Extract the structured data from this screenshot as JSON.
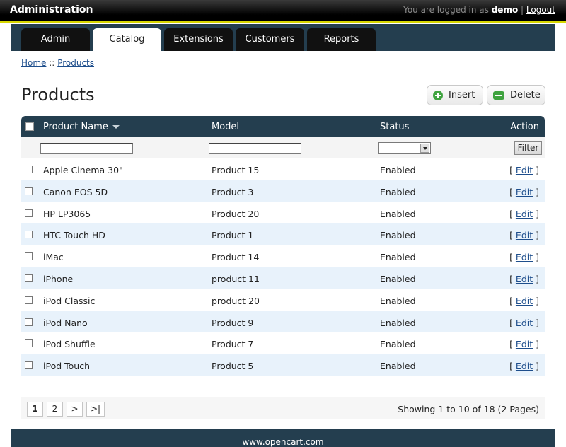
{
  "header": {
    "title": "Administration",
    "logged_in_text": "You are logged in as",
    "username": "demo",
    "separator": "|",
    "logout_label": "Logout"
  },
  "tabs": [
    {
      "label": "Admin",
      "active": false
    },
    {
      "label": "Catalog",
      "active": true
    },
    {
      "label": "Extensions",
      "active": false
    },
    {
      "label": "Customers",
      "active": false
    },
    {
      "label": "Reports",
      "active": false
    }
  ],
  "breadcrumb": {
    "home": "Home",
    "separator": "::",
    "current": "Products"
  },
  "page": {
    "title": "Products",
    "insert_label": "Insert",
    "delete_label": "Delete"
  },
  "table": {
    "columns": {
      "name": "Product Name",
      "model": "Model",
      "status": "Status",
      "action": "Action"
    },
    "filter": {
      "button_label": "Filter",
      "name_value": "",
      "model_value": "",
      "status_value": ""
    },
    "rows": [
      {
        "name": "Apple Cinema 30\"",
        "model": "Product 15",
        "status": "Enabled",
        "action": "Edit"
      },
      {
        "name": "Canon EOS 5D",
        "model": "Product 3",
        "status": "Enabled",
        "action": "Edit"
      },
      {
        "name": "HP LP3065",
        "model": "Product 20",
        "status": "Enabled",
        "action": "Edit"
      },
      {
        "name": "HTC Touch HD",
        "model": "Product 1",
        "status": "Enabled",
        "action": "Edit"
      },
      {
        "name": "iMac",
        "model": "Product 14",
        "status": "Enabled",
        "action": "Edit"
      },
      {
        "name": "iPhone",
        "model": "product 11",
        "status": "Enabled",
        "action": "Edit"
      },
      {
        "name": "iPod Classic",
        "model": "product 20",
        "status": "Enabled",
        "action": "Edit"
      },
      {
        "name": "iPod Nano",
        "model": "Product 9",
        "status": "Enabled",
        "action": "Edit"
      },
      {
        "name": "iPod Shuffle",
        "model": "Product 7",
        "status": "Enabled",
        "action": "Edit"
      },
      {
        "name": "iPod Touch",
        "model": "Product 5",
        "status": "Enabled",
        "action": "Edit"
      }
    ]
  },
  "pagination": {
    "pages": [
      "1",
      "2",
      ">",
      ">|"
    ],
    "current": "1",
    "info": "Showing 1 to 10 of 18 (2 Pages)"
  },
  "footer": {
    "link": "www.opencart.com"
  },
  "colors": {
    "navy": "#243e4f",
    "accent_line": "#d6d600",
    "row_alt": "#e8f2fb",
    "link": "#1e4e8c",
    "icon_green": "#3fa33f"
  }
}
